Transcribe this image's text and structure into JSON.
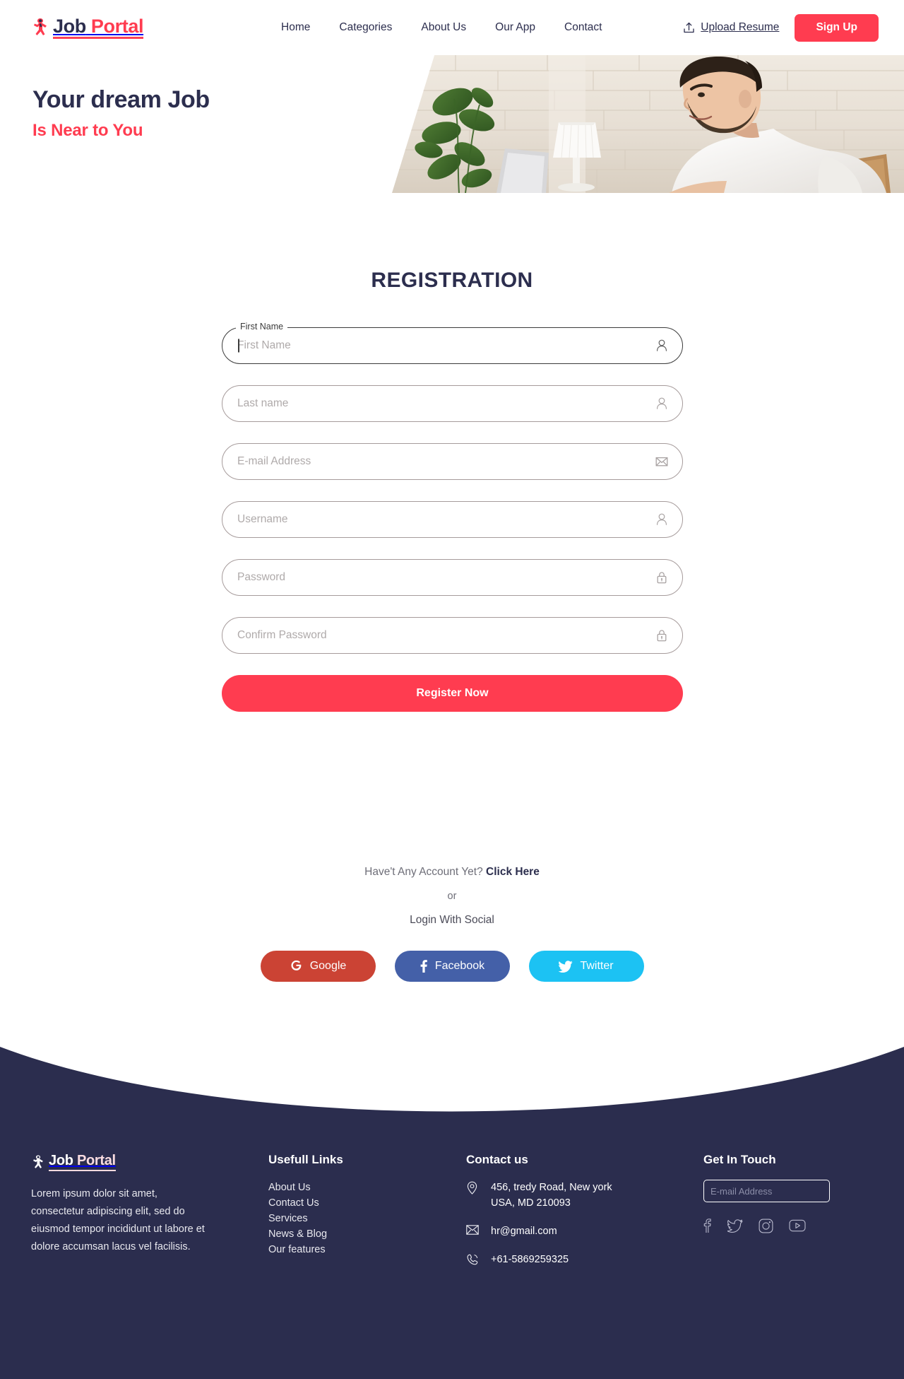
{
  "header": {
    "logo": {
      "word1": "Job",
      "word2": "Portal",
      "icon": "runner-logo-icon"
    },
    "nav": [
      {
        "label": "Home"
      },
      {
        "label": "Categories"
      },
      {
        "label": "About Us"
      },
      {
        "label": "Our App"
      },
      {
        "label": "Contact"
      }
    ],
    "upload_label": "Upload Resume",
    "signup_label": "Sign Up"
  },
  "hero": {
    "title": "Your dream Job",
    "subtitle": "Is Near to You"
  },
  "registration": {
    "title": "REGISTRATION",
    "fields": [
      {
        "name": "first-name",
        "label": "First Name",
        "placeholder": "First Name",
        "value": "",
        "icon": "user-icon",
        "focused": true
      },
      {
        "name": "last-name",
        "placeholder": "Last name",
        "value": "",
        "icon": "user-icon",
        "focused": false
      },
      {
        "name": "email",
        "placeholder": "E-mail Address",
        "value": "",
        "icon": "envelope-icon",
        "focused": false
      },
      {
        "name": "username",
        "placeholder": "Username",
        "value": "",
        "icon": "user-icon",
        "focused": false
      },
      {
        "name": "password",
        "placeholder": "Password",
        "value": "",
        "icon": "lock-icon",
        "focused": false
      },
      {
        "name": "confirm-password",
        "placeholder": "Confirm Password",
        "value": "",
        "icon": "lock-icon",
        "focused": false
      }
    ],
    "submit_label": "Register Now"
  },
  "alt_login": {
    "have_account_text": "Have't Any Account Yet?",
    "click_here": "Click Here",
    "or": "or",
    "login_with_social": "Login With Social",
    "buttons": [
      {
        "label": "Google",
        "color": "#CB4334",
        "icon": "google-icon"
      },
      {
        "label": "Facebook",
        "color": "#4460A8",
        "icon": "facebook-icon"
      },
      {
        "label": "Twitter",
        "color": "#1CC2F3",
        "icon": "twitter-icon"
      }
    ]
  },
  "footer": {
    "logo": {
      "word1": "Job",
      "word2": "Portal",
      "icon": "runner-logo-icon"
    },
    "description": "Lorem ipsum dolor sit amet, consectetur adipiscing elit, sed do eiusmod tempor incididunt ut labore et dolore accumsan lacus vel facilisis.",
    "links_heading": "Usefull Links",
    "links": [
      {
        "label": "About Us"
      },
      {
        "label": "Contact Us"
      },
      {
        "label": "Services"
      },
      {
        "label": "News & Blog"
      },
      {
        "label": "Our features"
      }
    ],
    "contact_heading": "Contact us",
    "contact": {
      "address_line1": "456, tredy Road, New york",
      "address_line2": "USA, MD 210093",
      "email": "hr@gmail.com",
      "phone": "+61-5869259325"
    },
    "touch_heading": "Get In Touch",
    "subscribe_placeholder": "E-mail Address",
    "subscribe_value": "",
    "social_icons": [
      "facebook-icon",
      "twitter-icon",
      "instagram-icon",
      "youtube-icon"
    ]
  },
  "colors": {
    "accent_red": "#FF3C50",
    "navy": "#2C2E4E",
    "footer_bg": "#2B2D4E"
  }
}
